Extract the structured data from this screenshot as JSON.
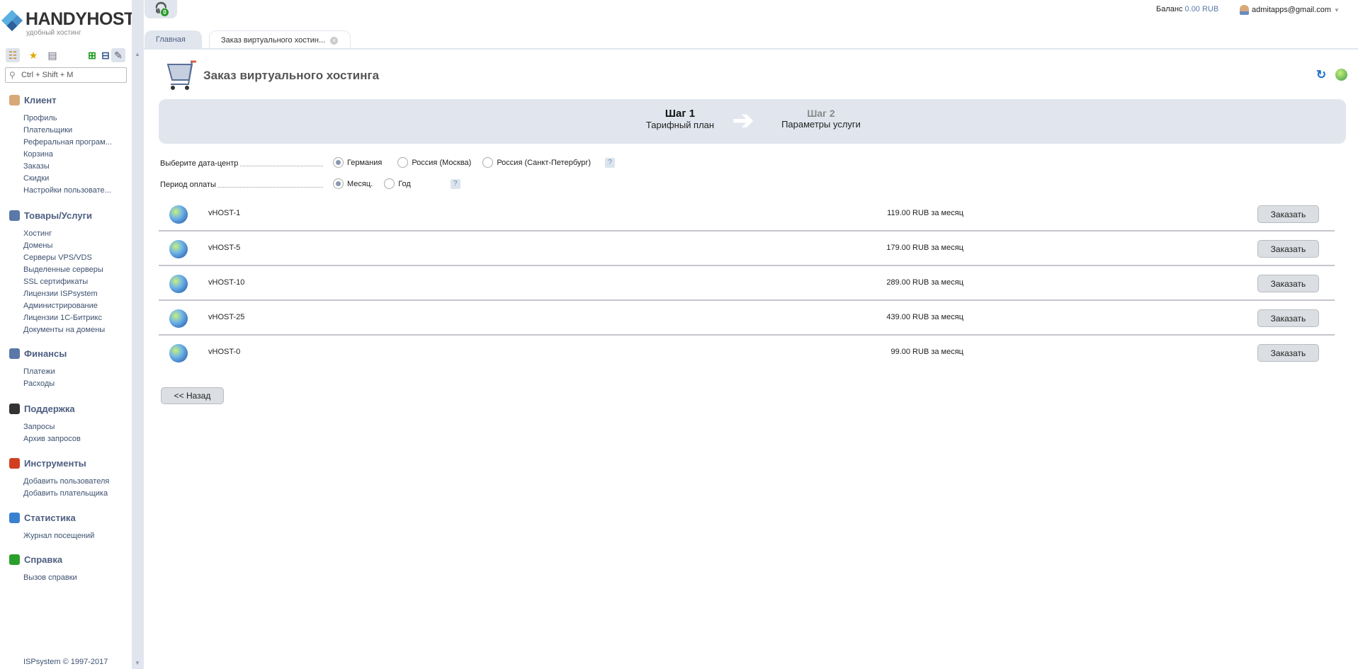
{
  "logo": {
    "name": "HANDYHOST",
    "tagline": "удобный хостинг"
  },
  "sidebar": {
    "search_placeholder": "Ctrl + Shift + M",
    "sections": [
      {
        "title": "Клиент",
        "icon": "user-icon",
        "items": [
          "Профиль",
          "Плательщики",
          "Реферальная програм...",
          "Корзина",
          "Заказы",
          "Скидки",
          "Настройки пользовате..."
        ]
      },
      {
        "title": "Товары/Услуги",
        "icon": "cart-icon",
        "items": [
          "Хостинг",
          "Домены",
          "Серверы VPS/VDS",
          "Выделенные серверы",
          "SSL сертификаты",
          "Лицензии ISPsystem",
          "Администрирование",
          "Лицензии 1С-Битрикс",
          "Документы на домены"
        ]
      },
      {
        "title": "Финансы",
        "icon": "cash-register-icon",
        "items": [
          "Платежи",
          "Расходы"
        ]
      },
      {
        "title": "Поддержка",
        "icon": "headset-icon",
        "items": [
          "Запросы",
          "Архив запросов"
        ]
      },
      {
        "title": "Инструменты",
        "icon": "tools-icon",
        "items": [
          "Добавить пользователя",
          "Добавить плательщика"
        ]
      },
      {
        "title": "Статистика",
        "icon": "pie-chart-icon",
        "items": [
          "Журнал посещений"
        ]
      },
      {
        "title": "Справка",
        "icon": "help-icon",
        "items": [
          "Вызов справки"
        ]
      }
    ],
    "footer": "ISPsystem © 1997-2017"
  },
  "header": {
    "support_count": "0",
    "balance_label": "Баланс",
    "balance_value": "0.00 RUB",
    "user": "admitapps@gmail.com"
  },
  "tabs": [
    {
      "label": "Главная",
      "active": false
    },
    {
      "label": "Заказ виртуального хостин...",
      "active": true
    }
  ],
  "page": {
    "title": "Заказ виртуального хостинга"
  },
  "steps": [
    {
      "title": "Шаг 1",
      "label": "Тарифный план",
      "active": true
    },
    {
      "title": "Шаг 2",
      "label": "Параметры услуги",
      "active": false
    }
  ],
  "form": {
    "datacenter": {
      "label": "Выберите дата-центр",
      "options": [
        "Германия",
        "Россия (Москва)",
        "Россия (Санкт-Петербург)"
      ],
      "selected": 0
    },
    "period": {
      "label": "Период оплаты",
      "options": [
        "Месяц.",
        "Год"
      ],
      "selected": 0
    },
    "help": "?"
  },
  "plans": [
    {
      "name": "vHOST-1",
      "price": "119.00 RUB за месяц"
    },
    {
      "name": "vHOST-5",
      "price": "179.00 RUB за месяц"
    },
    {
      "name": "vHOST-10",
      "price": "289.00 RUB за месяц"
    },
    {
      "name": "vHOST-25",
      "price": "439.00 RUB за месяц"
    },
    {
      "name": "vHOST-0",
      "price": "99.00 RUB за месяц"
    }
  ],
  "order_label": "Заказать",
  "back_label": "<< Назад",
  "colors": {
    "accent": "#4e5f80",
    "panel": "#e1e6ee",
    "link": "#3d5170"
  }
}
